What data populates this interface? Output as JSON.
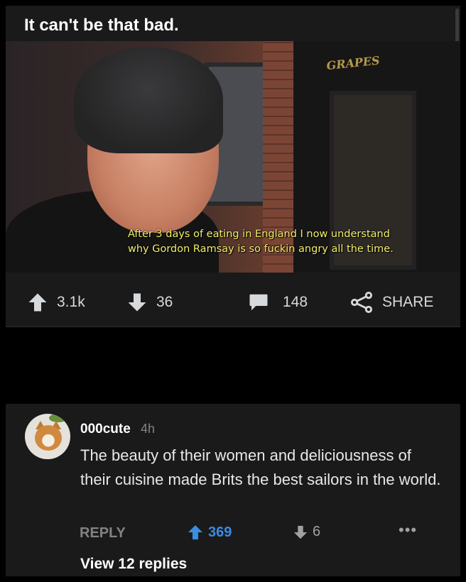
{
  "post": {
    "title": "It can't be that bad.",
    "video": {
      "subtitle_line1": "After 3 days of eating in England I now understand",
      "subtitle_line2": "why Gordon Ramsay is so fuckin angry all the time."
    },
    "actions": {
      "upvotes": "3.1k",
      "downvotes": "36",
      "comments": "148",
      "share_label": "SHARE"
    }
  },
  "comment": {
    "username": "000cute",
    "timestamp": "4h",
    "body": "The beauty of their women and deliciousness of their cuisine made Brits the best sailors in the world.",
    "reply_label": "REPLY",
    "upvotes": "369",
    "downvotes": "6",
    "more": "•••",
    "view_replies": "View 12 replies"
  },
  "colors": {
    "background": "#1a1a1b",
    "upvote_accent": "#3a8de0",
    "subtitle": "#f4ef6a",
    "muted": "#818384"
  },
  "icons": {
    "upvote": "arrow-up-icon",
    "downvote": "arrow-down-icon",
    "comments": "speech-bubble-icon",
    "share": "share-icon",
    "more": "ellipsis-icon"
  }
}
